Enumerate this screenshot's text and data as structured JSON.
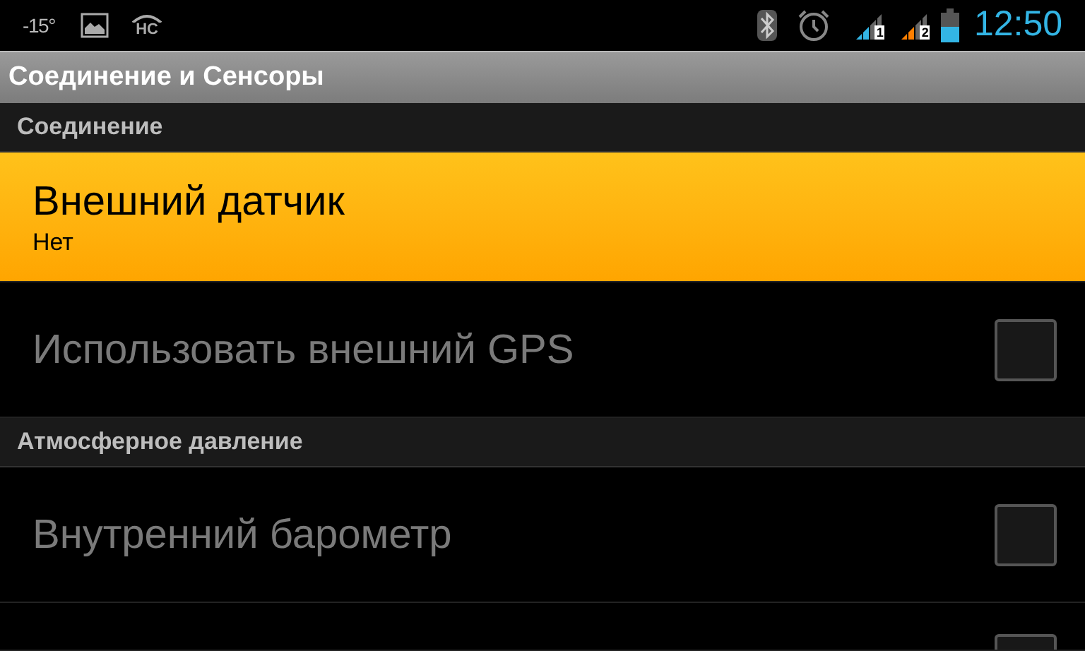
{
  "status_bar": {
    "temperature": "-15°",
    "notification_label": "HC",
    "sim_labels": [
      "1",
      "2"
    ],
    "time": "12:50"
  },
  "window": {
    "title": "Соединение и Сенсоры"
  },
  "sections": [
    {
      "header": "Соединение",
      "items": [
        {
          "kind": "list",
          "title": "Внешний датчик",
          "summary": "Нет",
          "selected": true,
          "disabled": false
        },
        {
          "kind": "checkbox",
          "title": "Использовать внешний GPS",
          "checked": false,
          "selected": false,
          "disabled": true
        }
      ]
    },
    {
      "header": "Атмосферное давление",
      "items": [
        {
          "kind": "checkbox",
          "title": "Внутренний барометр",
          "checked": false,
          "selected": false,
          "disabled": true
        },
        {
          "kind": "checkbox",
          "selected": false
        }
      ]
    }
  ]
}
